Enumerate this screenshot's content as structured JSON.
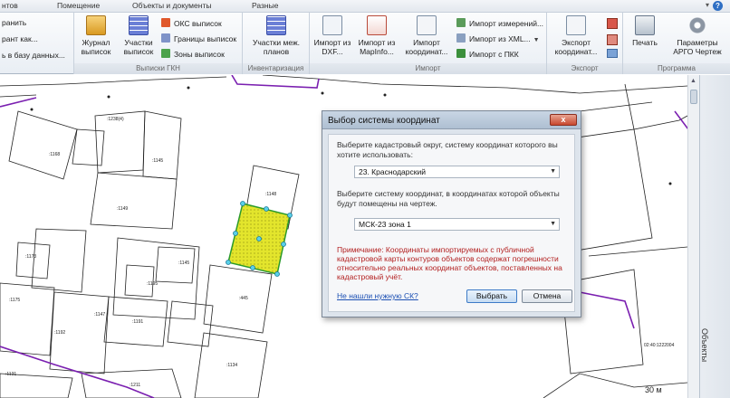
{
  "tabs": [
    "нтов",
    "Помещение",
    "Объекты и документы",
    "Разные"
  ],
  "help_glyph": "?",
  "chevron_glyph": "▾",
  "ribbon": {
    "left_items": [
      "ранить",
      "рант как...",
      "ь в базу данных..."
    ],
    "gkn": {
      "label": "Выписки ГКН",
      "journal": "Журнал выписок",
      "parcels": "Участки выписок",
      "oks": "ОКС выписок",
      "borders": "Границы выписок",
      "zones": "Зоны выписок"
    },
    "inv": {
      "label": "Инвентаризация",
      "parcels_plans": "Участки меж. планов"
    },
    "import": {
      "label": "Импорт",
      "dxf": "Импорт из DXF...",
      "mapinfo": "Импорт из MapInfo...",
      "coords": "Импорт координат...",
      "measurements": "Импорт измерений...",
      "xml": "Импорт из XML...",
      "pkk": "Импорт с ПКК"
    },
    "export": {
      "label": "Экспорт",
      "coords": "Экспорт координат..."
    },
    "program": {
      "label": "Программа",
      "print": "Печать",
      "params": "Параметры АРГО Чертеж"
    }
  },
  "sidepanel_label": "Объекты",
  "scale_label": "30 м",
  "dialog": {
    "title": "Выбор системы координат",
    "close_glyph": "x",
    "district_prompt": "Выберите кадастровый округ, систему координат которого вы хотите использовать:",
    "district_value": "23. Краснодарский",
    "cs_prompt": "Выберите систему координат, в координатах которой объекты будут помещены на чертеж.",
    "cs_value": "МСК-23 зона 1",
    "note": "Примечание: Координаты импортируемых с публичной кадастровой карты контуров объектов содержат погрешности относительно реальных координат объектов, поставленных на кадастровый учёт.",
    "not_found_link": "Не нашли нужную СК?",
    "select_button": "Выбрать",
    "cancel_button": "Отмена"
  },
  "map_labels": {
    "l1": ":1238(4)",
    "l2": ":1168",
    "l3": ":1145",
    "l4": ":1148",
    "l5": ":1149",
    "l6": ":1173",
    "l7": ":1145",
    "l8": ":1192",
    "l9": ":1195",
    "l10": ":1191",
    "l11": ":1147",
    "l12": ":445",
    "l13": ":1131",
    "l14": ":1134",
    "l15": ":1211",
    "l16": "02:40:1222004",
    "l17": ":1175"
  },
  "colors": {
    "parcel_fill": "#e3e52c",
    "parcel_border": "#2a9a2a",
    "boundary": "#7a1fb0",
    "note_red": "#b32020"
  }
}
